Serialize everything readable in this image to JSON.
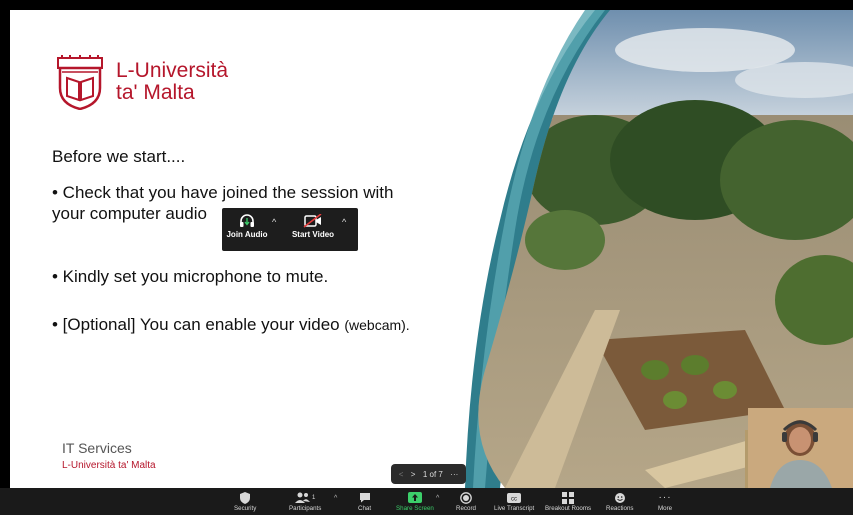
{
  "slide": {
    "logo": {
      "line1": "L-Università",
      "line2": "ta' Malta"
    },
    "intro": "Before we start....",
    "bullet_check_part1": "• Check that you have joined the session with",
    "bullet_check_part2": "your computer audio",
    "bullet_mute": "• Kindly set you microphone to mute.",
    "bullet_optional": "• [Optional] You can enable your video",
    "bullet_optional_suffix": "(webcam).",
    "snippet": {
      "join_audio": "Join Audio",
      "start_video": "Start Video"
    },
    "footer_title": "IT Services",
    "footer_sub": "L-Università ta' Malta"
  },
  "page_nav": {
    "label": "1 of 7",
    "more": "···"
  },
  "toolbar": {
    "security": "Security",
    "participants": "Participants",
    "participants_count": "1",
    "chat": "Chat",
    "share_screen": "Share Screen",
    "record": "Record",
    "live_transcript": "Live Transcript",
    "breakout_rooms": "Breakout Rooms",
    "reactions": "Reactions",
    "more": "More",
    "caret": "^"
  },
  "colors": {
    "brand": "#b5162b",
    "share_green": "#3ccf6a",
    "toolbar_bg": "#1a1a1a"
  }
}
